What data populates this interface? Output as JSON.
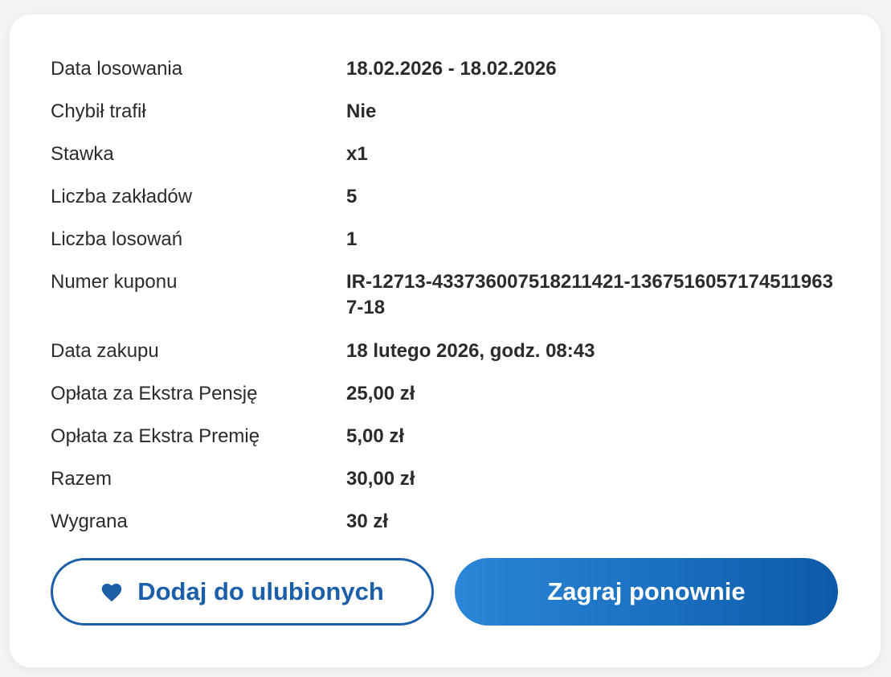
{
  "details": [
    {
      "label": "Data losowania",
      "value": "18.02.2026 - 18.02.2026"
    },
    {
      "label": "Chybił trafił",
      "value": "Nie"
    },
    {
      "label": "Stawka",
      "value": "x1"
    },
    {
      "label": "Liczba zakładów",
      "value": "5"
    },
    {
      "label": "Liczba losowań",
      "value": "1"
    },
    {
      "label": "Numer kuponu",
      "value": "IR-12713-433736007518211421-13675160571745119637-18"
    },
    {
      "label": "Data zakupu",
      "value": "18 lutego 2026, godz. 08:43"
    },
    {
      "label": "Opłata za Ekstra Pensję",
      "value": "25,00 zł"
    },
    {
      "label": "Opłata za Ekstra Premię",
      "value": "5,00 zł"
    },
    {
      "label": "Razem",
      "value": "30,00 zł"
    },
    {
      "label": "Wygrana",
      "value": "30 zł"
    }
  ],
  "buttons": {
    "favorite_label": "Dodaj do ulubionych",
    "favorite_icon": "heart-icon",
    "replay_label": "Zagraj ponownie"
  },
  "colors": {
    "primary": "#1a5fa8",
    "gradient_start": "#2a86d8",
    "gradient_end": "#0d5aa8"
  }
}
